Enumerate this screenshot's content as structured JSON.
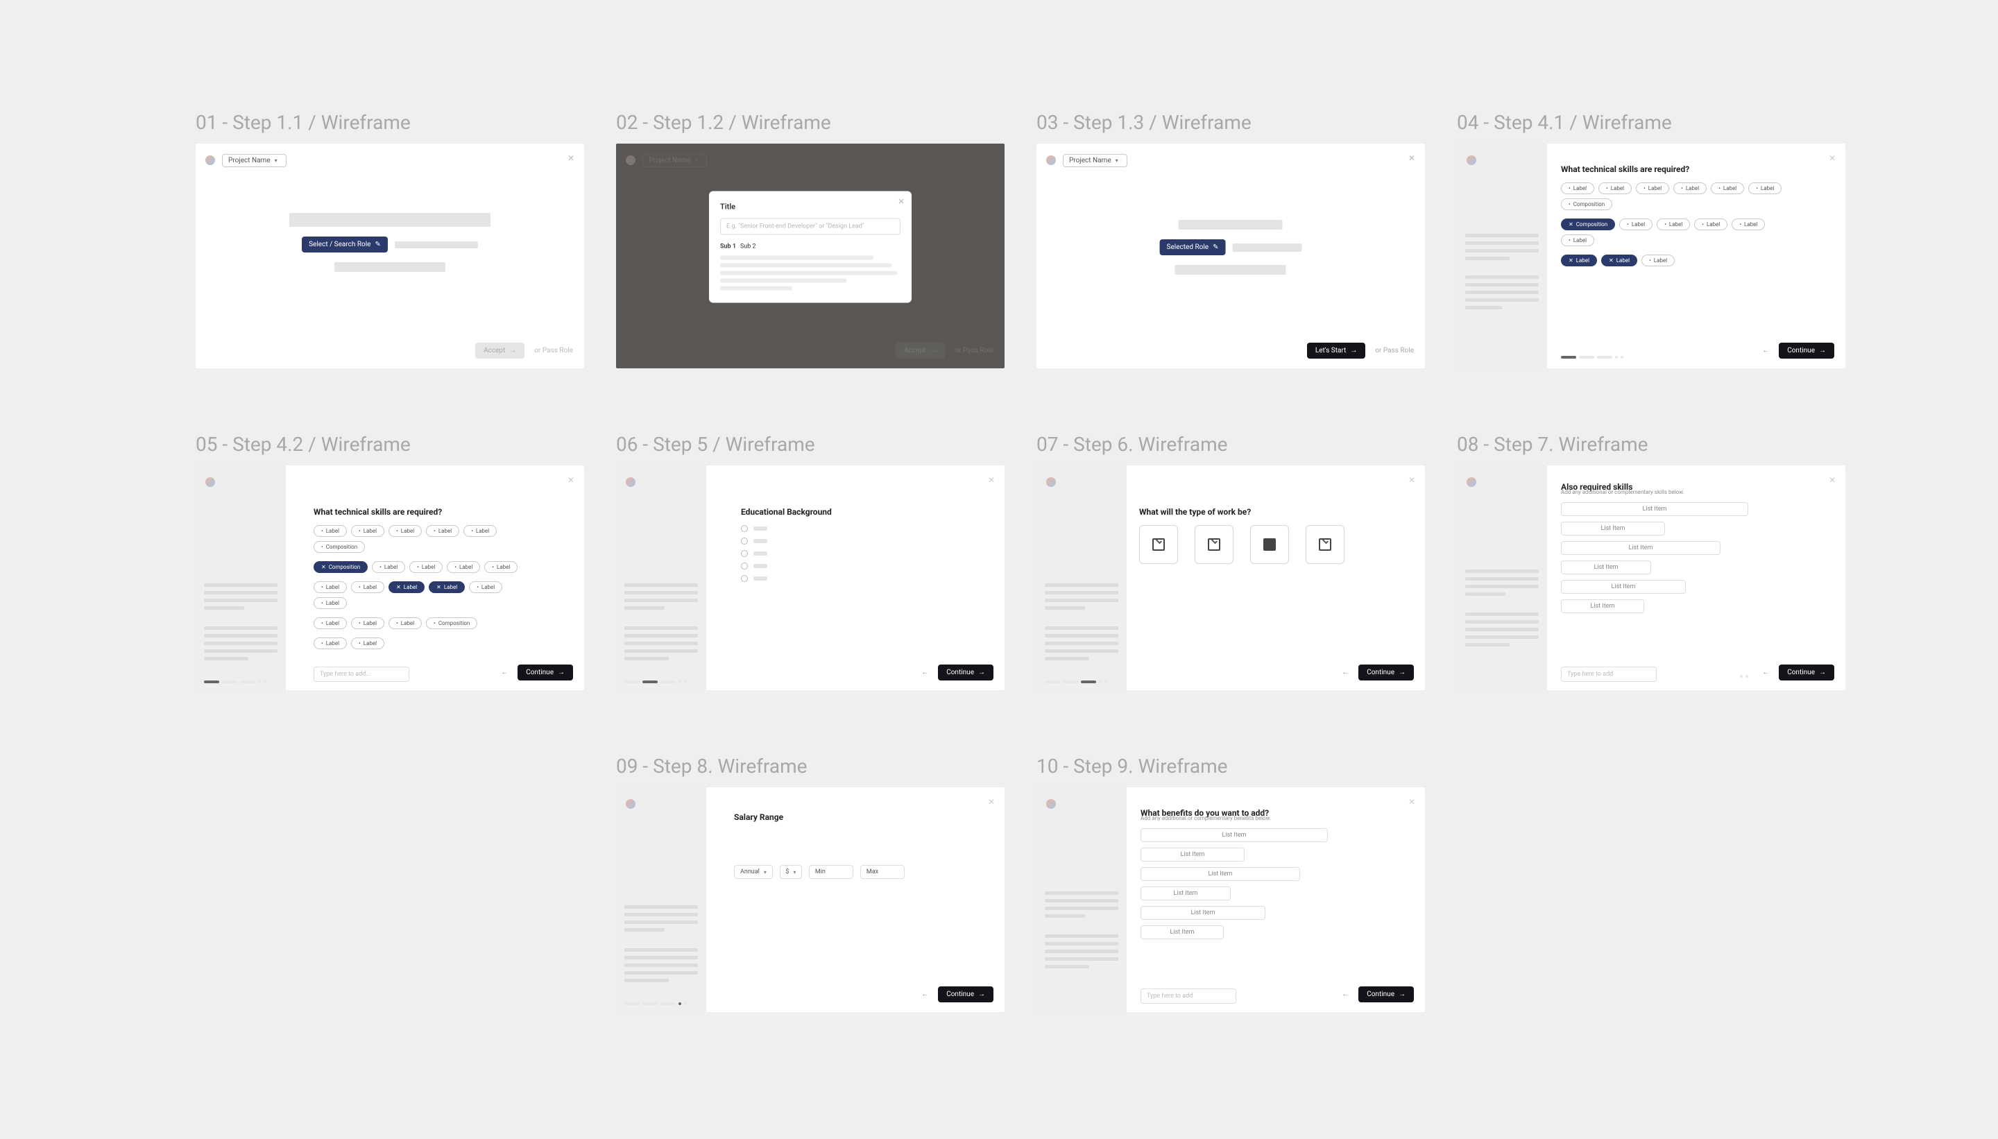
{
  "frames": {
    "f01": {
      "title": "01 - Step 1.1 / Wireframe",
      "project": "Project Name",
      "cta": "Select / Search Role",
      "icon": "✎",
      "primary": "Accept",
      "secondary": "or Pass Role"
    },
    "f02": {
      "title": "02 - Step 1.2 / Wireframe",
      "project": "Project Name",
      "modal": {
        "title": "Title",
        "placeholder": "E.g. \"Senior Front-end Developer\" or \"Design Lead\"",
        "subLabel": "Sub 1",
        "subVal": "Sub 2"
      },
      "secondary": "or Pass Role",
      "primary": "Accept"
    },
    "f03": {
      "title": "03 - Step 1.3 / Wireframe",
      "project": "Project Name",
      "cta": "Selected Role",
      "icon": "✎",
      "primary": "Let's Start",
      "secondary": "or Pass Role"
    },
    "f04": {
      "title": "04 - Step 4.1 / Wireframe",
      "heading": "What technical skills are required?",
      "continue": "Continue"
    },
    "f05": {
      "title": "05 - Step 4.2 / Wireframe",
      "heading": "What technical skills are required?",
      "continue": "Continue",
      "typeHere": "Type here to add..."
    },
    "f06": {
      "title": "06 - Step 5 / Wireframe",
      "heading": "Educational Background",
      "continue": "Continue"
    },
    "f07": {
      "title": "07 - Step 6. Wireframe",
      "heading": "What will the type of work be?",
      "continue": "Continue"
    },
    "f08": {
      "title": "08 - Step 7. Wireframe",
      "heading": "Also required skills",
      "sub": "Add any additional or complementary skills below.",
      "continue": "Continue",
      "typeHere": "Type here to add",
      "item": "List Item"
    },
    "f09": {
      "title": "09 - Step 8. Wireframe",
      "heading": "Salary Range",
      "continue": "Continue",
      "annual": "Annual",
      "currency": "$",
      "min": "Min",
      "max": "Max"
    },
    "f10": {
      "title": "10 - Step 9. Wireframe",
      "heading": "What benefits do you want to add?",
      "sub": "Add any additional or complementary benefits below.",
      "continue": "Continue",
      "typeHere": "Type here to add",
      "item": "List Item"
    }
  },
  "tags": {
    "row_a": [
      "Label",
      "Label",
      "Label",
      "Label",
      "Label",
      "Label",
      "Label"
    ],
    "filled_a": [
      "Composition",
      "Label"
    ],
    "row_b": [
      "Label",
      "Label"
    ],
    "row_c": [
      "Label",
      "Composition",
      "Label",
      "Label",
      "Label"
    ]
  },
  "tags_b": {
    "rows": [
      [
        "Label",
        "Label",
        "Label",
        "Label",
        "Label",
        "Composition"
      ],
      [
        "Composition",
        "Label",
        "Label",
        "Label",
        "Label"
      ],
      [
        "Label",
        "Label",
        "Label",
        "Label",
        "Label",
        "Label"
      ],
      [
        "Label",
        "Label",
        "Label",
        "Composition"
      ],
      [
        "Label",
        "Label"
      ]
    ],
    "filled": [
      "Composition",
      "Label"
    ]
  }
}
